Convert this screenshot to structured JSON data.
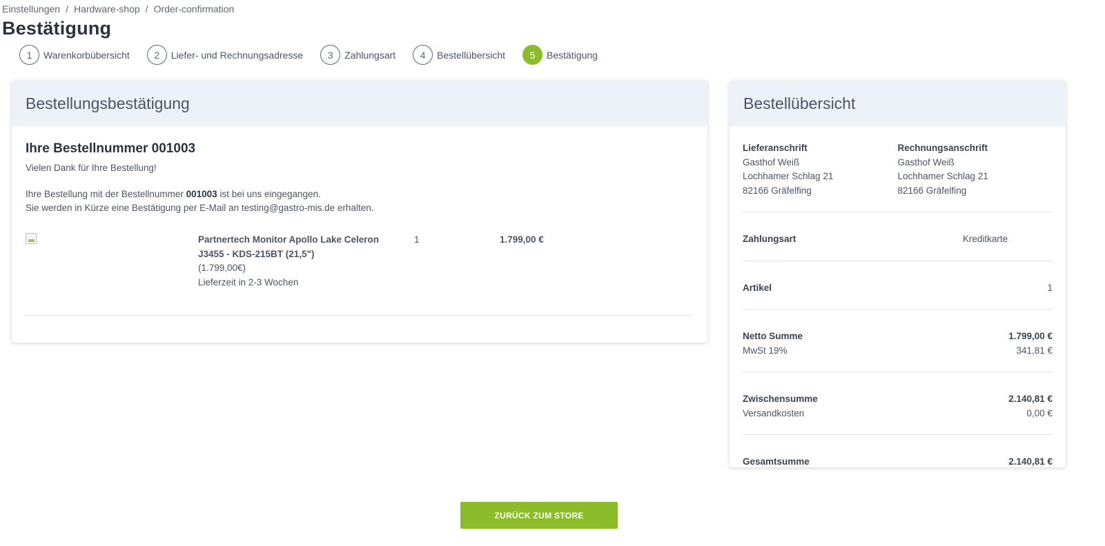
{
  "breadcrumb": {
    "items": [
      "Einstellungen",
      "Hardware-shop",
      "Order-confirmation"
    ],
    "separator": "/"
  },
  "page_title": "Bestätigung",
  "steps": [
    {
      "num": "1",
      "label": "Warenkorbübersicht"
    },
    {
      "num": "2",
      "label": "Liefer- und Rechnungsadresse"
    },
    {
      "num": "3",
      "label": "Zahlungsart"
    },
    {
      "num": "4",
      "label": "Bestellübersicht"
    },
    {
      "num": "5",
      "label": "Bestätigung",
      "active": true
    }
  ],
  "confirmation": {
    "header": "Bestellungsbestätigung",
    "heading": "Ihre Bestellnummer 001003",
    "thanks": "Vielen Dank für Ihre Bestellung!",
    "line1_pre": "Ihre Bestellung mit der Bestellnummer",
    "order_number": "001003",
    "line1_post": "ist bei uns eingegangen.",
    "line2": "Sie werden in Kürze eine Bestätigung per E-Mail an testing@gastro-mis.de erhalten.",
    "item": {
      "name": "Partnertech Monitor Apollo Lake Celeron J3455 - KDS-215BT (21,5\")",
      "unit_price": "(1.799,00€)",
      "delivery": "Lieferzeit in 2-3 Wochen",
      "qty": "1",
      "total": "1.799,00 €",
      "image_icon": "broken-image-icon"
    }
  },
  "summary": {
    "header": "Bestellübersicht",
    "shipping": {
      "label": "Lieferanschrift",
      "lines": [
        "Gasthof Weiß",
        "Lochhamer Schlag 21",
        "82166 Gräfelfing"
      ]
    },
    "billing": {
      "label": "Rechnungsanschrift",
      "lines": [
        "Gasthof Weiß",
        "Lochhamer Schlag 21",
        "82166 Gräfelfing"
      ]
    },
    "payment_label": "Zahlungsart",
    "payment_value": "Kreditkarte",
    "items_label": "Artikel",
    "items_value": "1",
    "net_label": "Netto Summe",
    "net_value": "1.799,00 €",
    "vat_label": "MwSt 19%",
    "vat_value": "341,81 €",
    "subtotal_label": "Zwischensumme",
    "subtotal_value": "2.140,81 €",
    "shipping_cost_label": "Versandkosten",
    "shipping_cost_value": "0,00 €",
    "grand_total_label": "Gesamtsumme",
    "grand_total_value": "2.140,81 €"
  },
  "back_button": "ZURÜCK ZUM STORE",
  "colors": {
    "accent": "#8cbc2a",
    "header_bg": "#edf2f9"
  }
}
